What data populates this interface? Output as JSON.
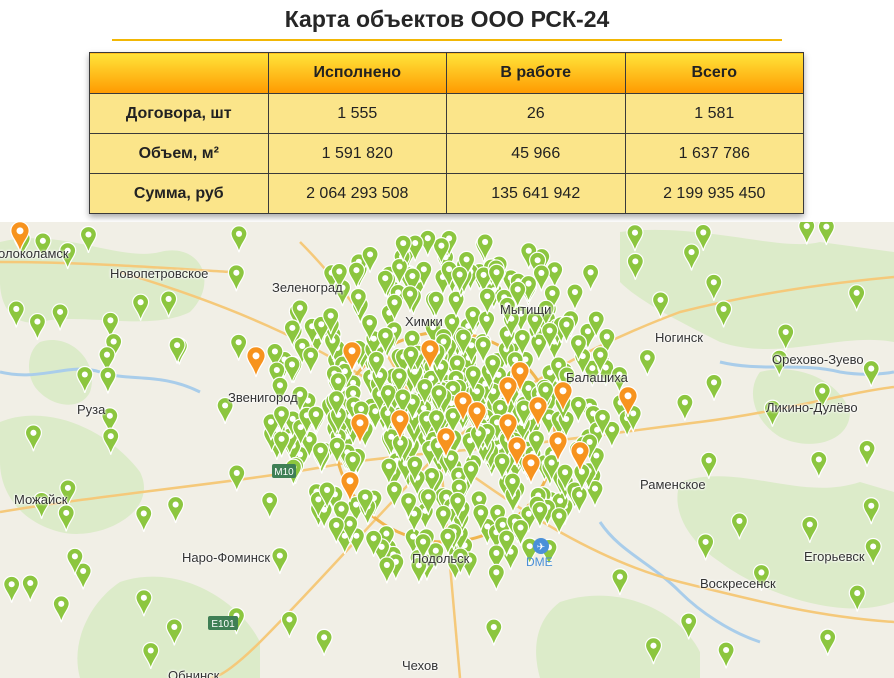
{
  "title": "Карта объектов ООО РСК-24",
  "table": {
    "columns": [
      "",
      "Исполнено",
      "В работе",
      "Всего"
    ],
    "rows": [
      {
        "label": "Договора, шт",
        "values": [
          "1 555",
          "26",
          "1 581"
        ]
      },
      {
        "label": "Объем, м²",
        "values": [
          "1 591 820",
          "45 966",
          "1 637 786"
        ]
      },
      {
        "label": "Сумма, руб",
        "values": [
          "2 064 293 508",
          "135 641 942",
          "2 199 935 450"
        ]
      }
    ]
  },
  "map": {
    "cities": [
      "олоколамск",
      "Новопетровское",
      "Зеленоград",
      "Ногинск",
      "Орехово-Зуево",
      "Звенигород",
      "Руза",
      "Ликино-Дулёво",
      "Раменское",
      "Можайск",
      "Наро-Фоминск",
      "Подольск",
      "Егорьевск",
      "Воскресенск",
      "Обнинск",
      "Чехов",
      "Химки",
      "Балашиха",
      "Мытищи"
    ],
    "road_labels": [
      "E101",
      "M10"
    ],
    "airport_labels": [
      "DME"
    ],
    "marker_colors": {
      "done": "#8cc63f",
      "in_progress": "#f7931e"
    }
  }
}
